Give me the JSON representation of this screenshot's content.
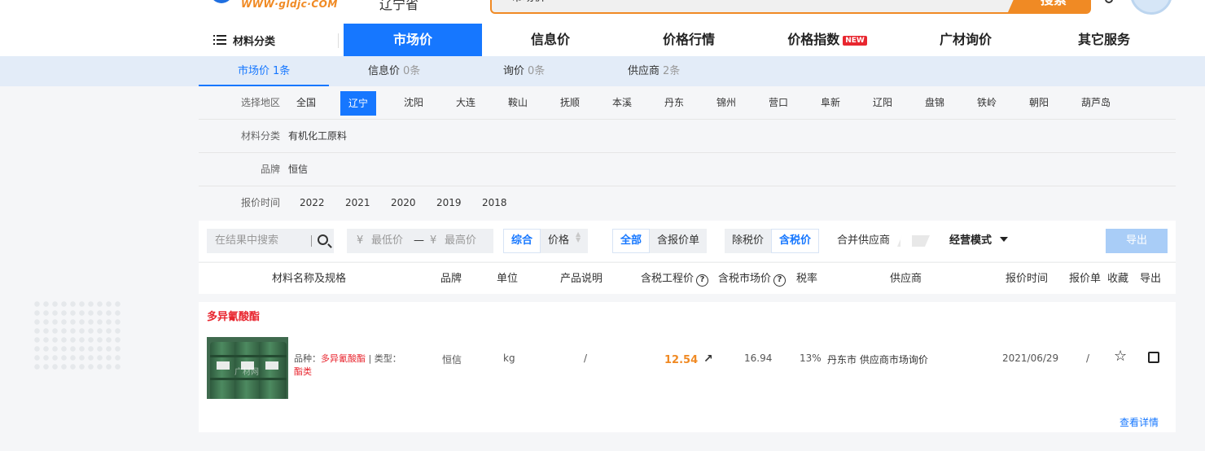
{
  "header": {
    "logo_text": "WWW·gldjc·COM",
    "region": "辽宁省",
    "search_type": "市场价",
    "search_button": "搜索"
  },
  "nav": {
    "category_menu": "材料分类",
    "items": [
      "市场价",
      "信息价",
      "价格行情",
      "价格指数",
      "广材询价",
      "其它服务"
    ],
    "new_badge": "NEW"
  },
  "subtabs": [
    {
      "label": "市场价",
      "count": "1条"
    },
    {
      "label": "信息价",
      "count": "0条"
    },
    {
      "label": "询价",
      "count": "0条"
    },
    {
      "label": "供应商",
      "count": "2条"
    }
  ],
  "filters": {
    "region_label": "选择地区",
    "regions": [
      "全国",
      "辽宁",
      "沈阳",
      "大连",
      "鞍山",
      "抚顺",
      "本溪",
      "丹东",
      "锦州",
      "营口",
      "阜新",
      "辽阳",
      "盘锦",
      "铁岭",
      "朝阳",
      "葫芦岛"
    ],
    "category_label": "材料分类",
    "category_value": "有机化工原料",
    "brand_label": "品牌",
    "brand_value": "恒信",
    "time_label": "报价时间",
    "years": [
      "2022",
      "2021",
      "2020",
      "2019",
      "2018"
    ]
  },
  "toolbar": {
    "search_placeholder": "在结果中搜索",
    "currency": "¥",
    "min_price": "最低价",
    "range_dash": "—",
    "max_price": "最高价",
    "sort_general": "综合",
    "sort_price": "价格",
    "filter_all": "全部",
    "filter_quote": "含报价单",
    "tax_excl": "除税价",
    "tax_incl": "含税价",
    "merge_supplier": "合并供应商",
    "business_mode": "经营模式",
    "export": "导出"
  },
  "table": {
    "headers": [
      "材料名称及规格",
      "品牌",
      "单位",
      "产品说明",
      "含税工程价",
      "含税市场价",
      "税率",
      "供应商",
      "报价时间",
      "报价单",
      "收藏",
      "导出"
    ],
    "help_mark": "?"
  },
  "result": {
    "title": "多异氰酸酯",
    "watermark": "广材网",
    "variety_label": "品种：",
    "variety_value": "多异氰酸酯",
    "type_label": " | 类型：",
    "type_value": "酯类",
    "brand": "恒信",
    "unit": "kg",
    "description": "/",
    "engineering_price": "12.54",
    "market_price": "16.94",
    "tax_rate": "13%",
    "supplier": "丹东市 供应商市场询价",
    "quote_time": "2021/06/29",
    "quote_sheet": "/",
    "detail_link": "查看详情"
  }
}
